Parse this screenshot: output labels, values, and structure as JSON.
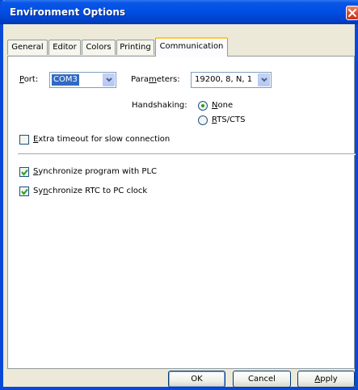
{
  "window": {
    "title": "Environment Options"
  },
  "tabs": [
    {
      "label": "General"
    },
    {
      "label": "Editor"
    },
    {
      "label": "Colors"
    },
    {
      "label": "Printing"
    },
    {
      "label": "Communication",
      "active": true
    }
  ],
  "communication": {
    "port": {
      "label_u": "P",
      "label_rest": "ort:",
      "value": "COM3"
    },
    "parameters": {
      "label_pre": "Para",
      "label_u": "m",
      "label_rest": "eters:",
      "value": "19200, 8, N, 1"
    },
    "handshaking": {
      "label": "Handshaking:",
      "options": [
        {
          "label_u": "N",
          "label_rest": "one",
          "selected": true
        },
        {
          "label_u": "R",
          "label_rest": "TS/CTS",
          "selected": false
        }
      ]
    },
    "extra_timeout": {
      "label_u": "E",
      "label_rest": "xtra timeout for slow connection",
      "checked": false
    },
    "sync_program": {
      "label_u": "S",
      "label_rest": "ynchronize program with PLC",
      "checked": true
    },
    "sync_rtc": {
      "label_pre": "Sy",
      "label_u": "n",
      "label_rest": "chronize RTC to PC clock",
      "checked": true
    }
  },
  "buttons": {
    "ok": "OK",
    "cancel": "Cancel",
    "apply_u": "A",
    "apply_rest": "pply"
  },
  "icons": [
    "close-icon",
    "chevron-down-icon",
    "checkmark-icon"
  ],
  "colors": {
    "title_bar": "#0050E6",
    "dialog_bg": "#ECE9D8",
    "tab_highlight": "#FFC83C",
    "selection": "#316AC5"
  }
}
